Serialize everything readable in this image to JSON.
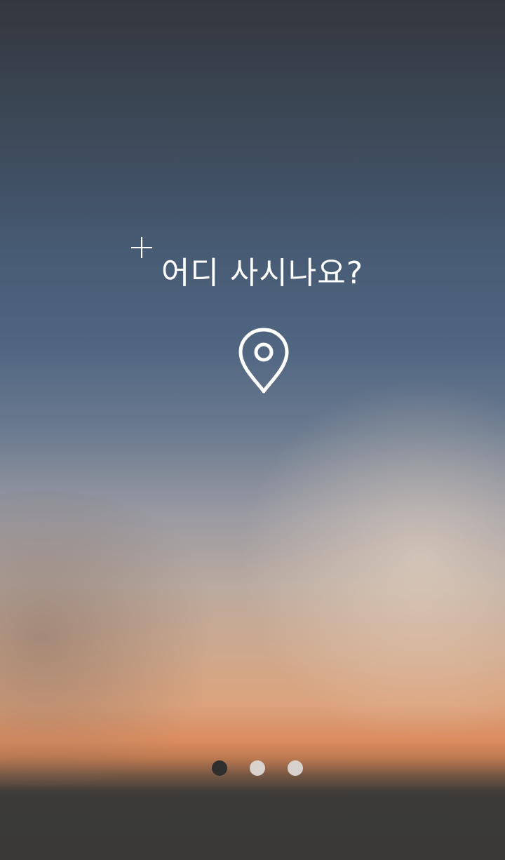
{
  "onboarding": {
    "title": "어디 사시나요?",
    "icons": {
      "sparkle": "plus-sparkle-icon",
      "location": "location-pin-icon"
    },
    "pager": {
      "total": 3,
      "active_index": 0
    }
  },
  "colors": {
    "text": "#ffffff",
    "dot_active": "#2f2f30",
    "dot_inactive": "#d8d2cf"
  }
}
